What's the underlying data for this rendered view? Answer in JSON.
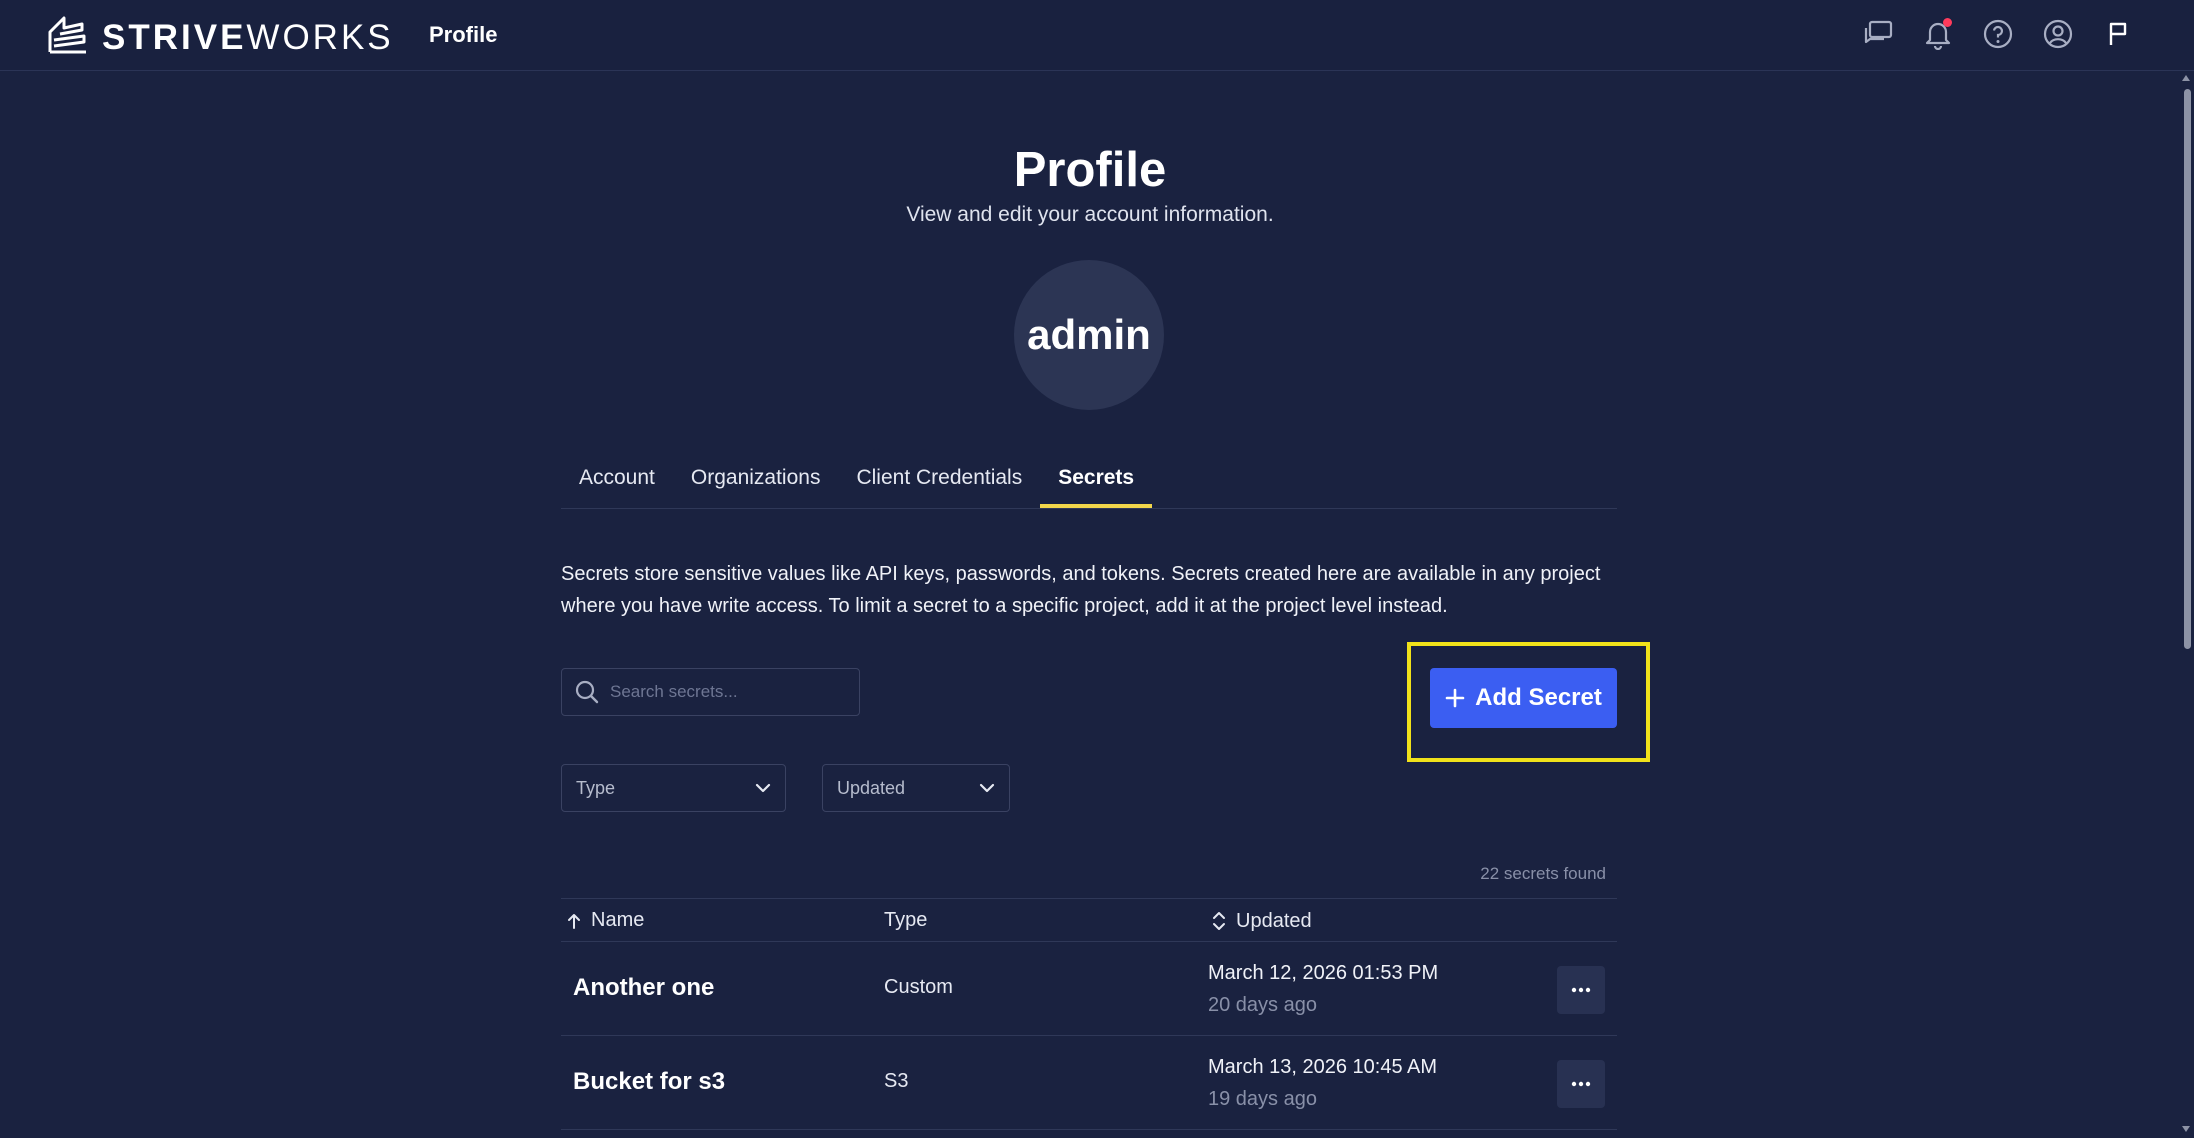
{
  "brand": {
    "strong": "STRIVE",
    "light": "WORKS"
  },
  "header": {
    "title": "Profile"
  },
  "page": {
    "title": "Profile",
    "subtitle": "View and edit your account information.",
    "avatar_text": "admin"
  },
  "tabs": [
    {
      "label": "Account",
      "active": false
    },
    {
      "label": "Organizations",
      "active": false
    },
    {
      "label": "Client Credentials",
      "active": false
    },
    {
      "label": "Secrets",
      "active": true
    }
  ],
  "description": "Secrets store sensitive values like API keys, passwords, and tokens. Secrets created here are available in any project where you have write access. To limit a secret to a specific project, add it at the project level instead.",
  "search": {
    "placeholder": "Search secrets..."
  },
  "add_button": {
    "label": "Add Secret"
  },
  "filters": {
    "type_label": "Type",
    "updated_label": "Updated"
  },
  "count_text": "22 secrets found",
  "table": {
    "columns": {
      "name": "Name",
      "type": "Type",
      "updated": "Updated"
    },
    "rows": [
      {
        "name": "Another one",
        "type": "Custom",
        "date": "March 12, 2026 01:53 PM",
        "ago": "20 days ago"
      },
      {
        "name": "Bucket for s3",
        "type": "S3",
        "date": "March 13, 2026 10:45 AM",
        "ago": "19 days ago"
      }
    ]
  },
  "colors": {
    "background": "#1a2240",
    "accent": "#3b5ef2",
    "tab_indicator": "#f2d64b",
    "highlight": "#f1e21a",
    "notification": "#ff3b5c"
  },
  "icons": [
    "striveworks-logo",
    "feedback-icon",
    "bell-icon",
    "help-icon",
    "user-circle-icon",
    "flag-icon",
    "search-icon",
    "plus-icon",
    "chevron-down-icon",
    "sort-up-icon",
    "sort-icon",
    "more-icon"
  ]
}
